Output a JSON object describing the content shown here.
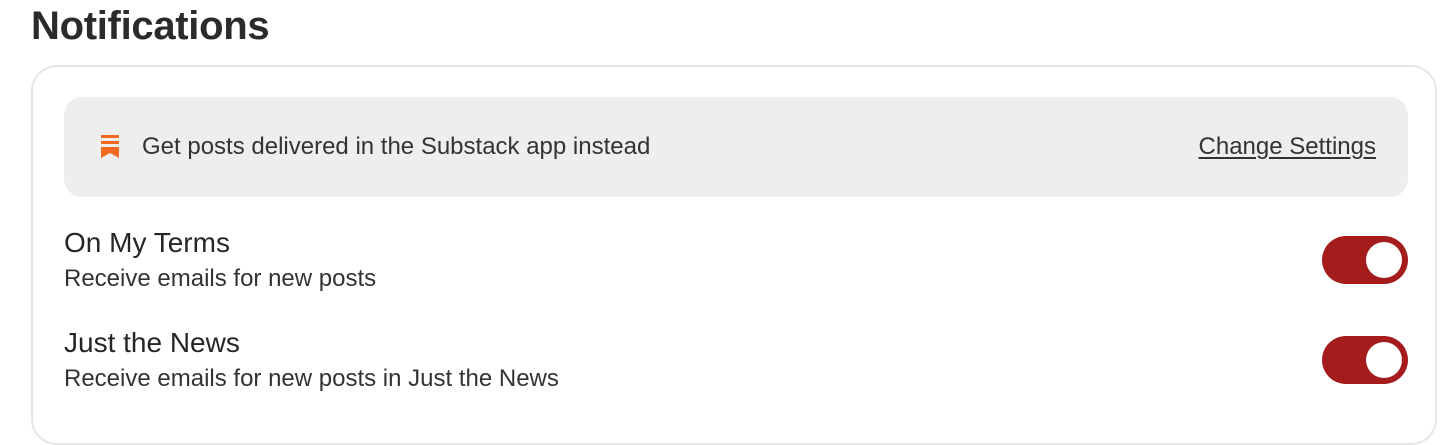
{
  "page": {
    "title": "Notifications"
  },
  "banner": {
    "icon": "substack-bookmark-icon",
    "icon_color": "#f26a21",
    "text": "Get posts delivered in the Substack app instead",
    "link_label": "Change Settings"
  },
  "subscriptions": [
    {
      "title": "On My Terms",
      "description": "Receive emails for new posts",
      "enabled": true
    },
    {
      "title": "Just the News",
      "description": "Receive emails for new posts in Just the News",
      "enabled": true
    }
  ],
  "colors": {
    "toggle_on": "#a51c1c",
    "banner_background": "#eeeeee"
  }
}
